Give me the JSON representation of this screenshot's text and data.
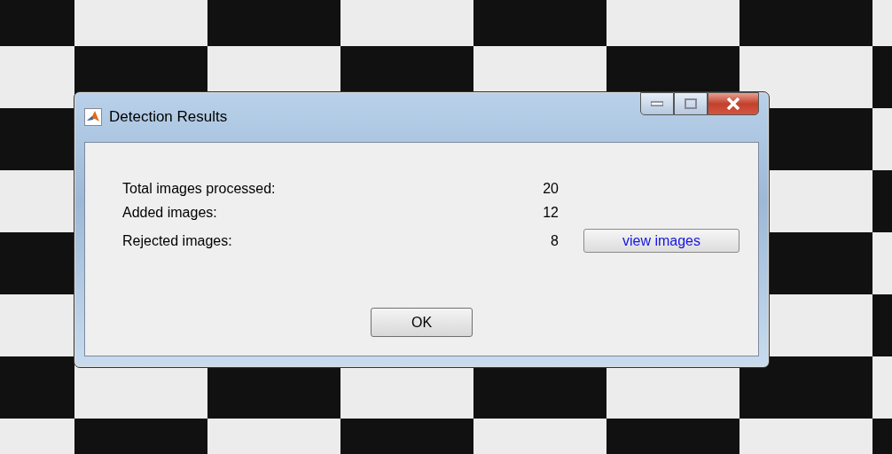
{
  "window": {
    "title": "Detection Results"
  },
  "stats": [
    {
      "label": "Total images processed:",
      "value": "20"
    },
    {
      "label": "Added images:",
      "value": "12"
    },
    {
      "label": "Rejected images:",
      "value": "8",
      "button": "view images"
    }
  ],
  "ok_button": "OK"
}
